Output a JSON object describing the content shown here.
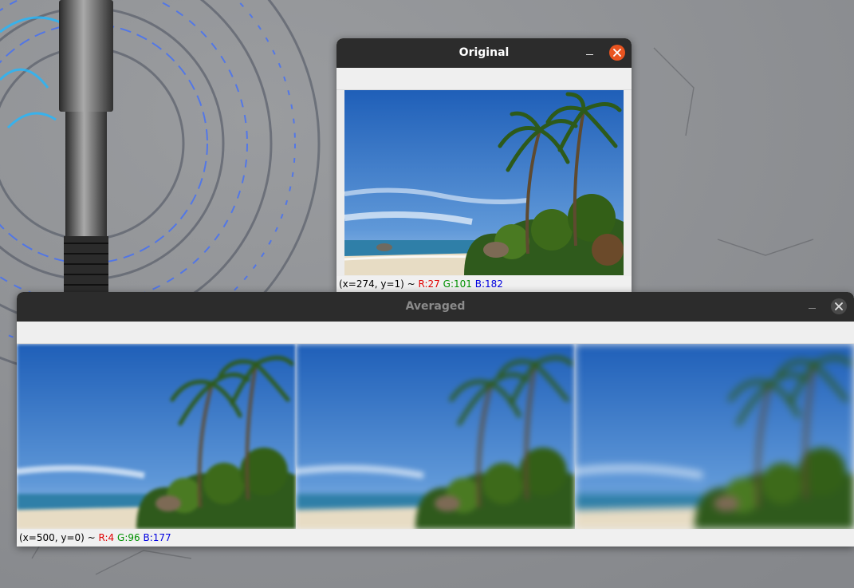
{
  "windows": {
    "original": {
      "title": "Original",
      "status": {
        "coords": "(x=274, y=1) ~ ",
        "r": "R:27",
        "g": "G:101",
        "b": "B:182"
      }
    },
    "averaged": {
      "title": "Averaged",
      "status": {
        "coords": "(x=500, y=0) ~ ",
        "r": "R:4",
        "g": "G:96",
        "b": "B:177"
      },
      "blur_levels": [
        "low",
        "medium",
        "high"
      ]
    }
  },
  "colors": {
    "title_active": "#ffffff",
    "title_inactive": "#8b8b8b",
    "close_active": "#e95420",
    "sky": "#2f6fc4"
  },
  "icons": [
    "minimize-icon",
    "close-icon"
  ]
}
